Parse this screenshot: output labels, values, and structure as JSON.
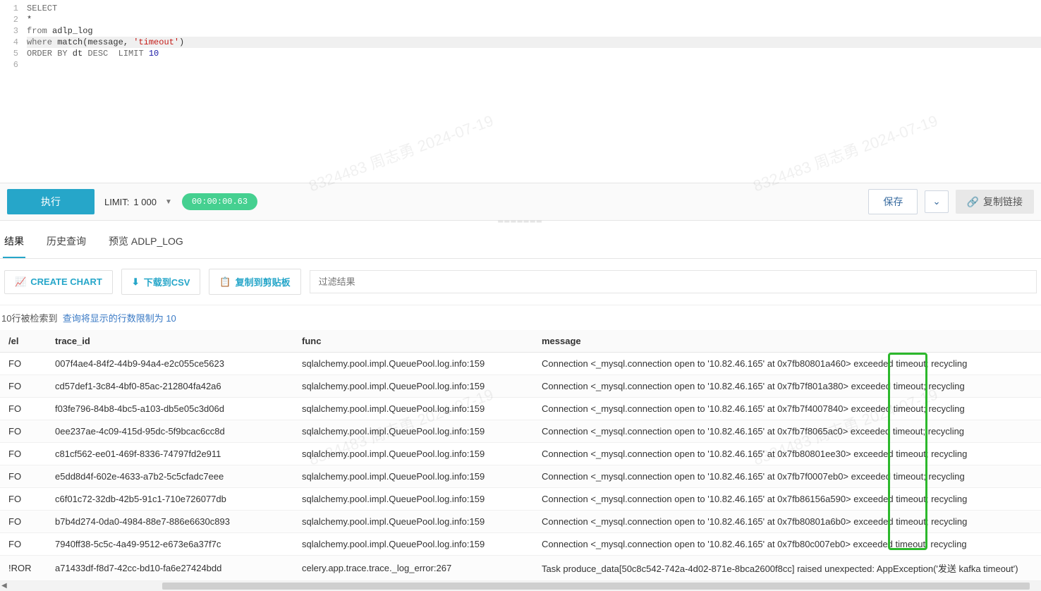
{
  "editor": {
    "lines": [
      {
        "n": "1",
        "text": "SELECT"
      },
      {
        "n": "2",
        "text": "*"
      },
      {
        "n": "3",
        "text": "from adlp_log"
      },
      {
        "n": "4",
        "text": "where match(message, 'timeout')"
      },
      {
        "n": "5",
        "text": "ORDER BY dt DESC  LIMIT 10"
      },
      {
        "n": "6",
        "text": ""
      }
    ]
  },
  "watermark": "8324483 周志勇 2024-07-19",
  "toolbar": {
    "run": "执行",
    "limit_label": "LIMIT:",
    "limit_value": "1 000",
    "elapsed": "00:00:00.63",
    "save": "保存",
    "copy_link": "复制链接"
  },
  "tabs": {
    "results": "结果",
    "history": "历史查询",
    "preview": "预览 ADLP_LOG"
  },
  "result_toolbar": {
    "create_chart": "CREATE CHART",
    "download_csv": "下载到CSV",
    "copy_clip": "复制到剪贴板",
    "filter_placeholder": "过滤结果"
  },
  "row_info": {
    "retrieved": "10行被检索到",
    "limit_link": "查询将显示的行数限制为 10"
  },
  "columns": {
    "level": "/el",
    "trace_id": "trace_id",
    "func": "func",
    "message": "message"
  },
  "rows": [
    {
      "level": "FO",
      "trace_id": "007f4ae4-84f2-44b9-94a4-e2c055ce5623",
      "func": "sqlalchemy.pool.impl.QueuePool.log.info:159",
      "message": "Connection <_mysql.connection open to '10.82.46.165' at 0x7fb80801a460> exceeded timeout; recycling"
    },
    {
      "level": "FO",
      "trace_id": "cd57def1-3c84-4bf0-85ac-212804fa42a6",
      "func": "sqlalchemy.pool.impl.QueuePool.log.info:159",
      "message": "Connection <_mysql.connection open to '10.82.46.165' at 0x7fb7f801a380> exceeded timeout; recycling"
    },
    {
      "level": "FO",
      "trace_id": "f03fe796-84b8-4bc5-a103-db5e05c3d06d",
      "func": "sqlalchemy.pool.impl.QueuePool.log.info:159",
      "message": "Connection <_mysql.connection open to '10.82.46.165' at 0x7fb7f4007840> exceeded timeout; recycling"
    },
    {
      "level": "FO",
      "trace_id": "0ee237ae-4c09-415d-95dc-5f9bcac6cc8d",
      "func": "sqlalchemy.pool.impl.QueuePool.log.info:159",
      "message": "Connection <_mysql.connection open to '10.82.46.165' at 0x7fb7f8065ac0> exceeded timeout; recycling"
    },
    {
      "level": "FO",
      "trace_id": "c81cf562-ee01-469f-8336-74797fd2e911",
      "func": "sqlalchemy.pool.impl.QueuePool.log.info:159",
      "message": "Connection <_mysql.connection open to '10.82.46.165' at 0x7fb80801ee30> exceeded timeout; recycling"
    },
    {
      "level": "FO",
      "trace_id": "e5dd8d4f-602e-4633-a7b2-5c5cfadc7eee",
      "func": "sqlalchemy.pool.impl.QueuePool.log.info:159",
      "message": "Connection <_mysql.connection open to '10.82.46.165' at 0x7fb7f0007eb0> exceeded timeout; recycling"
    },
    {
      "level": "FO",
      "trace_id": "c6f01c72-32db-42b5-91c1-710e726077db",
      "func": "sqlalchemy.pool.impl.QueuePool.log.info:159",
      "message": "Connection <_mysql.connection open to '10.82.46.165' at 0x7fb86156a590> exceeded timeout; recycling"
    },
    {
      "level": "FO",
      "trace_id": "b7b4d274-0da0-4984-88e7-886e6630c893",
      "func": "sqlalchemy.pool.impl.QueuePool.log.info:159",
      "message": "Connection <_mysql.connection open to '10.82.46.165' at 0x7fb80801a6b0> exceeded timeout; recycling"
    },
    {
      "level": "FO",
      "trace_id": "7940ff38-5c5c-4a49-9512-e673e6a37f7c",
      "func": "sqlalchemy.pool.impl.QueuePool.log.info:159",
      "message": "Connection <_mysql.connection open to '10.82.46.165' at 0x7fb80c007eb0> exceeded timeout; recycling"
    },
    {
      "level": "!ROR",
      "trace_id": "a71433df-f8d7-42cc-bd10-fa6e27424bdd",
      "func": "celery.app.trace.trace._log_error:267",
      "message": "Task produce_data[50c8c542-742a-4d02-871e-8bca2600f8cc] raised unexpected: AppException('发送 kafka timeout')"
    }
  ]
}
